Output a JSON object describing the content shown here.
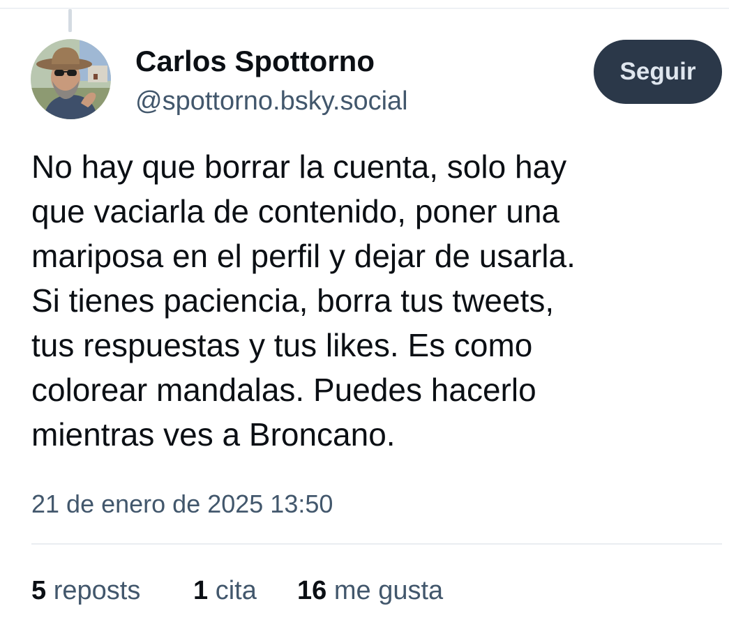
{
  "author": {
    "display_name": "Carlos Spottorno",
    "handle": "@spottorno.bsky.social"
  },
  "follow_button": {
    "label": "Seguir"
  },
  "post": {
    "lines": [
      "No hay que borrar la cuenta, solo hay",
      "que vaciarla de contenido, poner una",
      "mariposa en el perfil y dejar de usarla.",
      "Si tienes paciencia, borra tus tweets,",
      "tus respuestas y tus likes. Es como",
      "colorear mandalas. Puedes hacerlo",
      "mientras ves a Broncano."
    ],
    "timestamp": "21 de enero de 2025 13:50"
  },
  "stats": {
    "reposts": {
      "count": "5",
      "label": "reposts"
    },
    "quotes": {
      "count": "1",
      "label": "cita"
    },
    "likes": {
      "count": "16",
      "label": "me gusta"
    }
  },
  "colors": {
    "text_primary": "#0b0f14",
    "text_secondary": "#42576c",
    "follow_button_bg": "#2b3849",
    "follow_button_text": "#dfe6ee"
  }
}
